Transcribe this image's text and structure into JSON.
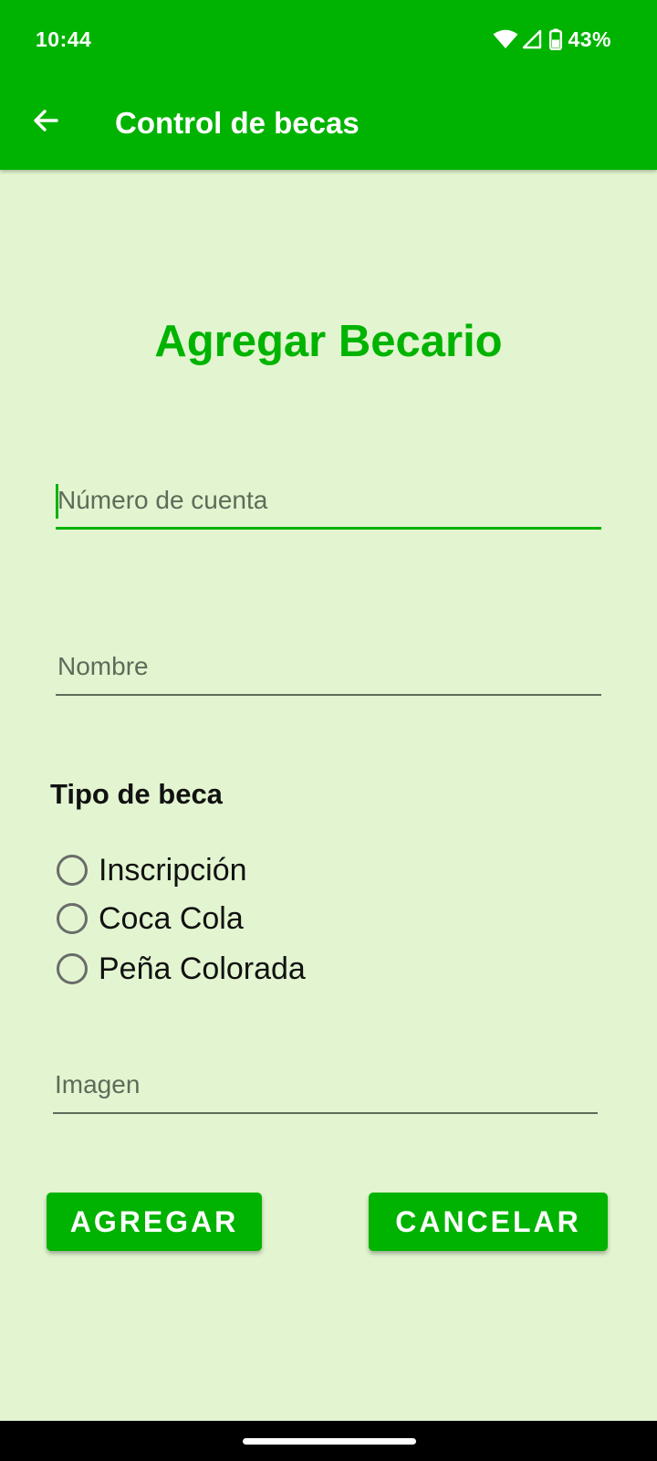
{
  "status_bar": {
    "time": "10:44",
    "battery": "43%",
    "icons": [
      "wifi-icon",
      "cell-signal-icon",
      "battery-icon"
    ]
  },
  "toolbar": {
    "title": "Control de becas",
    "back_icon": "arrow-left-icon"
  },
  "form": {
    "heading": "Agregar Becario",
    "account_number": {
      "placeholder": "Número de cuenta",
      "value": ""
    },
    "name": {
      "placeholder": "Nombre",
      "value": ""
    },
    "scholarship_type": {
      "label": "Tipo de beca",
      "options": [
        "Inscripción",
        "Coca Cola",
        "Peña Colorada"
      ],
      "selected": null
    },
    "image": {
      "placeholder": "Imagen",
      "value": ""
    }
  },
  "buttons": {
    "add": "AGREGAR",
    "cancel": "CANCELAR"
  },
  "colors": {
    "primary": "#00b300",
    "background": "#e2f5d0",
    "field_line": "#5f6b5a"
  }
}
